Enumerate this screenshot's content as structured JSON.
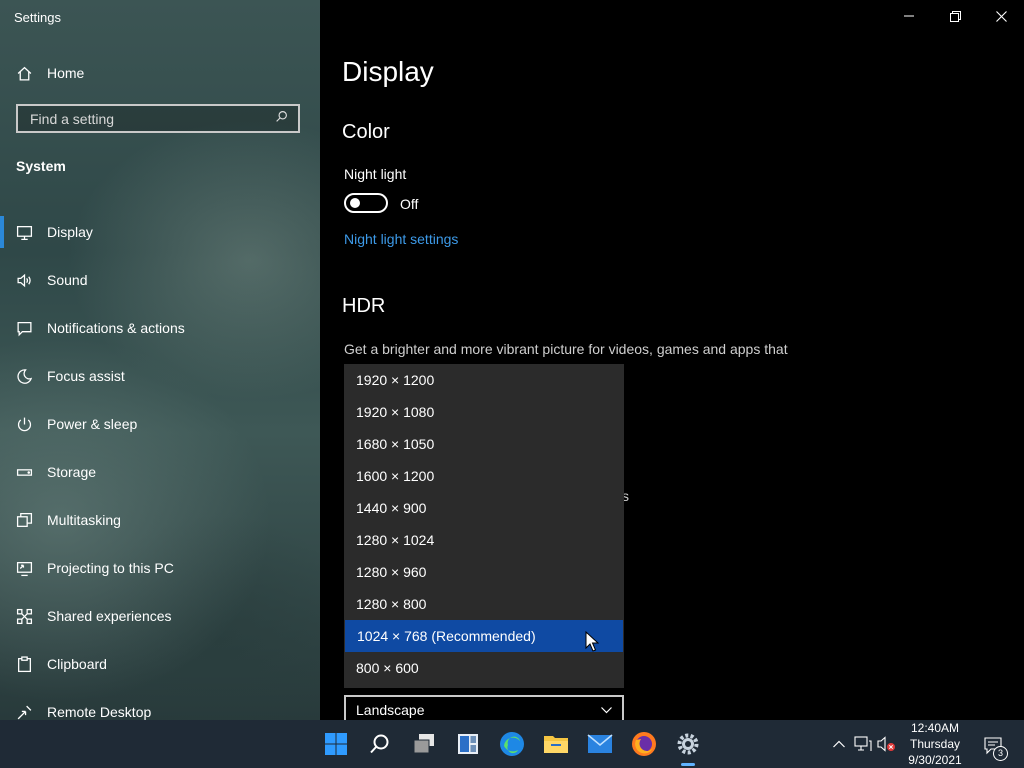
{
  "window": {
    "title": "Settings"
  },
  "sidebar": {
    "home_label": "Home",
    "search_placeholder": "Find a setting",
    "section": "System",
    "items": [
      {
        "label": "Display",
        "icon": "monitor-icon",
        "active": true
      },
      {
        "label": "Sound",
        "icon": "speaker-icon"
      },
      {
        "label": "Notifications & actions",
        "icon": "notification-icon"
      },
      {
        "label": "Focus assist",
        "icon": "moon-icon"
      },
      {
        "label": "Power & sleep",
        "icon": "power-icon"
      },
      {
        "label": "Storage",
        "icon": "storage-icon"
      },
      {
        "label": "Multitasking",
        "icon": "multitasking-icon"
      },
      {
        "label": "Projecting to this PC",
        "icon": "projecting-icon"
      },
      {
        "label": "Shared experiences",
        "icon": "shared-experiences-icon"
      },
      {
        "label": "Clipboard",
        "icon": "clipboard-icon"
      },
      {
        "label": "Remote Desktop",
        "icon": "remote-desktop-icon"
      }
    ]
  },
  "main": {
    "title": "Display",
    "color_heading": "Color",
    "night_light_label": "Night light",
    "night_light_state": "Off",
    "night_light_link": "Night light settings",
    "hdr_heading": "HDR",
    "hdr_description": "Get a brighter and more vibrant picture for videos, games and apps that",
    "stray_glyph": "s",
    "resolution_options": [
      "1920 × 1200",
      "1920 × 1080",
      "1680 × 1050",
      "1600 × 1200",
      "1440 × 900",
      "1280 × 1024",
      "1280 × 960",
      "1280 × 800",
      "1024 × 768 (Recommended)",
      "800 × 600"
    ],
    "selected_resolution_index": 8,
    "orientation_value": "Landscape"
  },
  "taskbar": {
    "apps": [
      "start-icon",
      "search-icon",
      "task-view-icon",
      "widgets-icon",
      "edge-icon",
      "file-explorer-icon",
      "mail-icon",
      "firefox-icon",
      "settings-icon"
    ],
    "clock": {
      "time": "12:40AM",
      "day": "Thursday",
      "date": "9/30/2021"
    },
    "notification_count": "3"
  },
  "colors": {
    "accent": "#0f4aa3",
    "link": "#3d9ae8",
    "taskbar": "#1f2a36"
  }
}
